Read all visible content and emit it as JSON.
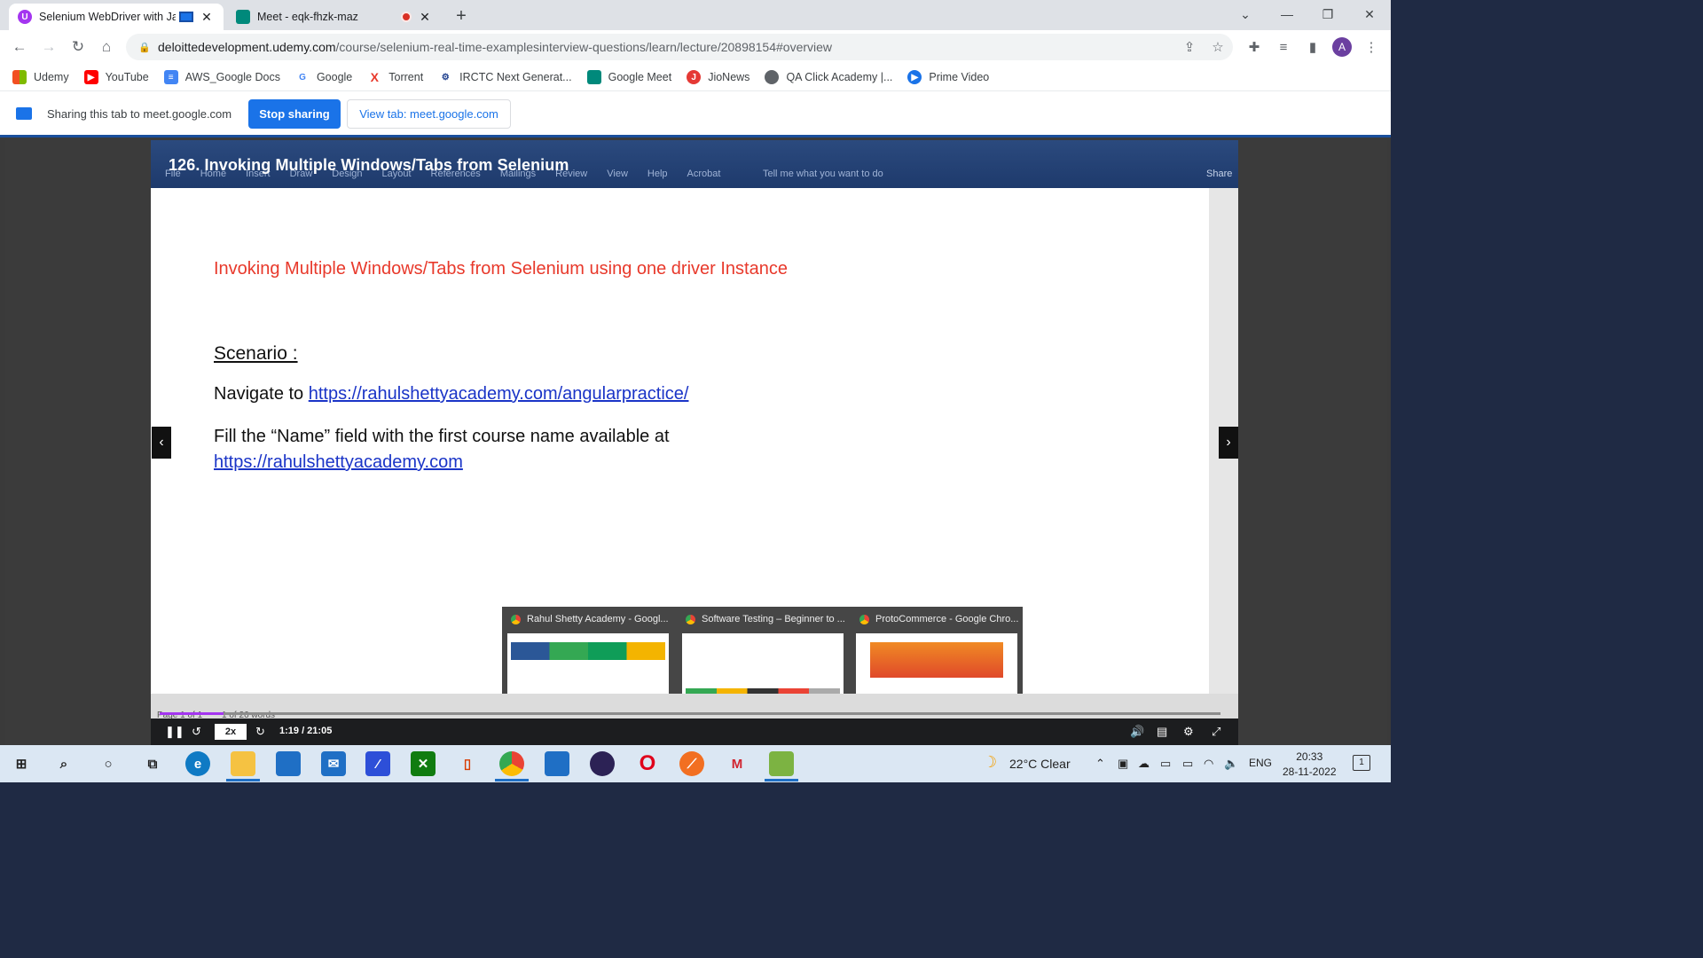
{
  "browser": {
    "tabs": [
      {
        "title": "Selenium WebDriver with Ja",
        "active": true
      },
      {
        "title": "Meet - eqk-fhzk-maz",
        "active": false
      }
    ],
    "url_host": "deloittedevelopment.udemy.com",
    "url_path": "/course/selenium-real-time-examplesinterview-questions/learn/lecture/20898154#overview",
    "profile_initial": "A"
  },
  "bookmarks": [
    "Udemy",
    "YouTube",
    "AWS_Google Docs",
    "Google",
    "Torrent",
    "IRCTC Next Generat...",
    "Google Meet",
    "JioNews",
    "QA Click Academy |...",
    "Prime Video"
  ],
  "share_bar": {
    "message": "Sharing this tab to meet.google.com",
    "stop_label": "Stop sharing",
    "view_label": "View tab: meet.google.com"
  },
  "word": {
    "menu": [
      "File",
      "Home",
      "Insert",
      "Draw",
      "Design",
      "Layout",
      "References",
      "Mailings",
      "Review",
      "View",
      "Help",
      "Acrobat"
    ],
    "tell_me": "Tell me what you want to do",
    "share": "Share",
    "status_page": "Page 1 of 1",
    "status_words": "1 of 26 words"
  },
  "lecture": {
    "title": "126. Invoking Multiple Windows/Tabs from Selenium"
  },
  "document": {
    "heading": "Invoking Multiple Windows/Tabs from Selenium using one driver Instance",
    "scenario_label": "Scenario :",
    "line1_text": "Navigate to ",
    "line1_link": "https://rahulshettyacademy.com/angularpractice/",
    "line2_text": "Fill the “Name” field with the first course name available at",
    "line2_link": "https://rahulshettyacademy.com"
  },
  "previews": [
    "Rahul Shetty Academy - Googl...",
    "Software Testing – Beginner to ...",
    "ProtoCommerce - Google Chro..."
  ],
  "player": {
    "speed": "2x",
    "time": "1:19 / 21:05",
    "progress": 0.06
  },
  "taskbar": {
    "weather": "22°C  Clear",
    "language": "ENG",
    "time": "20:33",
    "date": "28-11-2022",
    "notifications": "1"
  }
}
